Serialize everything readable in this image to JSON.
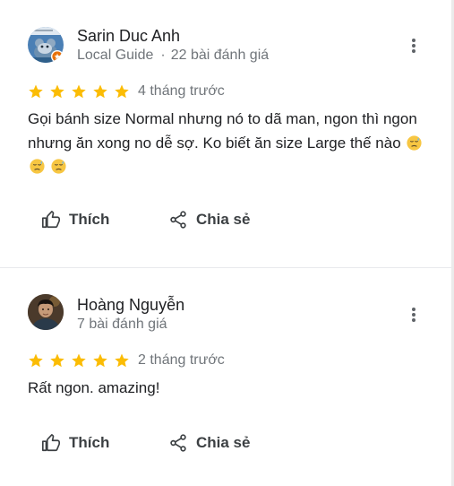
{
  "reviews": [
    {
      "author": "Sarin Duc Anh",
      "badge": "Local Guide",
      "review_count": "22 bài đánh giá",
      "stars": 5,
      "time": "4 tháng trước",
      "text": "Gọi bánh size Normal nhưng nó to dã man, ngon thì ngon nhưng ăn xong no dễ sợ. Ko biết ăn size Large thế nào",
      "emojis": [
        "downcast-sweat-emoji",
        "downcast-sweat-emoji",
        "downcast-sweat-emoji"
      ],
      "like_label": "Thích",
      "share_label": "Chia sẻ"
    },
    {
      "author": "Hoàng Nguyễn",
      "review_count": "7 bài đánh giá",
      "stars": 5,
      "time": "2 tháng trước",
      "text": "Rất ngon. amazing!",
      "like_label": "Thích",
      "share_label": "Chia sẻ"
    }
  ],
  "colors": {
    "star": "#fbbc04",
    "secondary_text": "#70757a",
    "divider": "#e8eaed",
    "local_guide_badge": "#e8710a"
  },
  "icons": [
    "kebab-menu-icon",
    "thumb-up-icon",
    "share-icon",
    "star-icon",
    "local-guide-badge-icon"
  ]
}
